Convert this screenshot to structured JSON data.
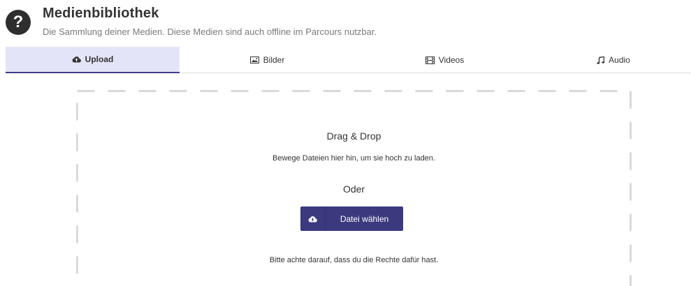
{
  "header": {
    "help_icon": "question-circle-icon",
    "title": "Medienbibliothek",
    "subtitle": "Die Sammlung deiner Medien. Diese Medien sind auch offline im Parcours nutzbar."
  },
  "tabs": [
    {
      "label": "Upload",
      "icon": "cloud-upload-icon",
      "active": true
    },
    {
      "label": "Bilder",
      "icon": "image-icon",
      "active": false
    },
    {
      "label": "Videos",
      "icon": "film-icon",
      "active": false
    },
    {
      "label": "Audio",
      "icon": "music-icon",
      "active": false
    }
  ],
  "dropzone": {
    "title": "Drag & Drop",
    "description": "Bewege Dateien hier hin, um sie hoch zu laden.",
    "or_label": "Oder",
    "button_label": "Datei wählen",
    "button_icon": "cloud-upload-icon",
    "note": "Bitte achte darauf, dass du die Rechte dafür hast."
  },
  "colors": {
    "accent": "#3b3a7e",
    "active_tab_bg": "#e3e4f7",
    "dash_border": "#d9d9d9"
  }
}
